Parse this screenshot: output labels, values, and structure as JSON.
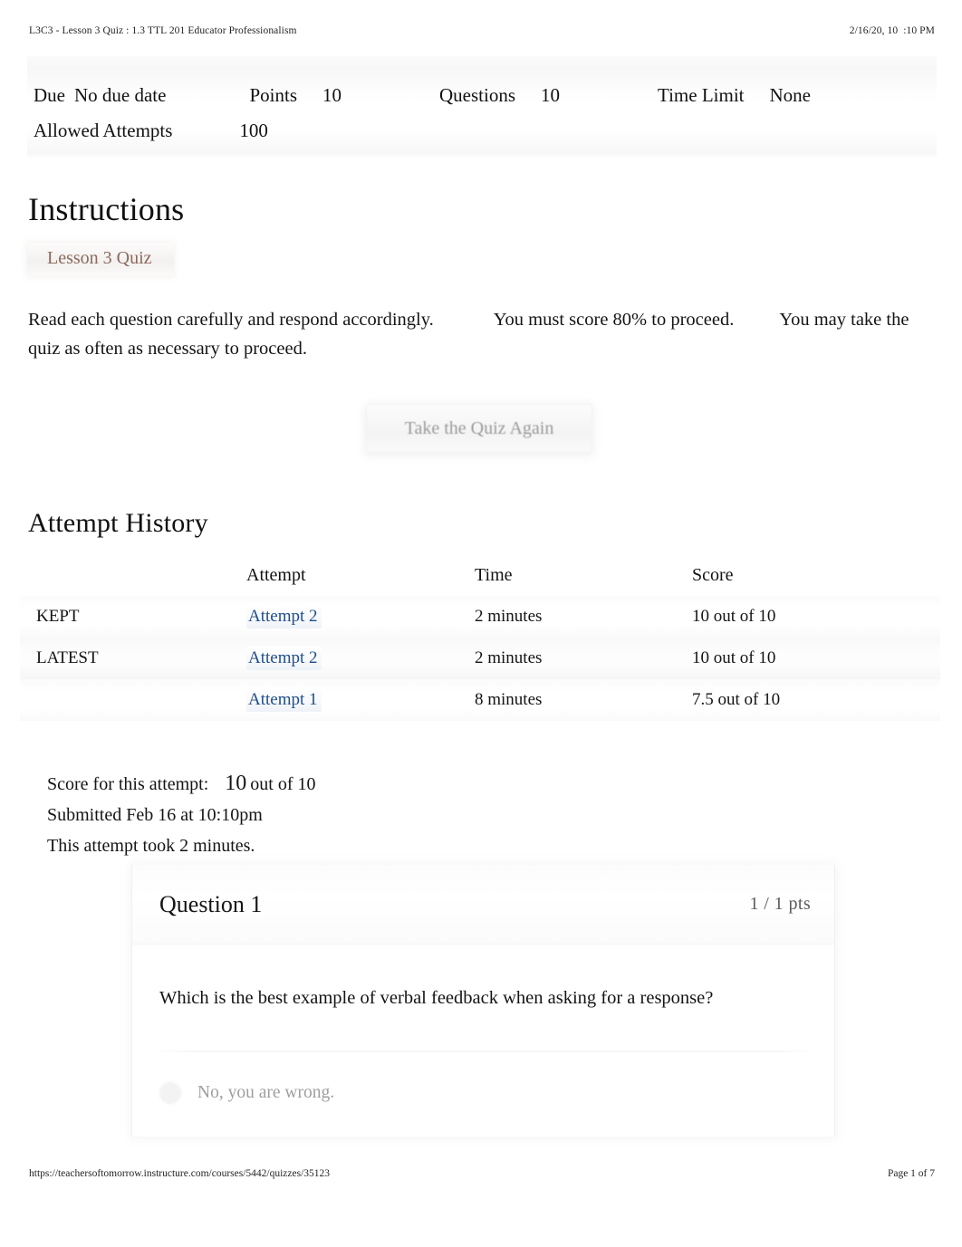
{
  "print_header": {
    "doc_title": "L3C3 - Lesson 3 Quiz : 1.3 TTL 201 Educator Professionalism",
    "timestamp": "2/16/20, 10  :10 PM"
  },
  "meta": {
    "due_label": "Due",
    "due_value": "No due date",
    "points_label": "Points",
    "points_value": "10",
    "questions_label": "Questions",
    "questions_value": "10",
    "time_limit_label": "Time Limit",
    "time_limit_value": "None",
    "allowed_attempts_label": "Allowed Attempts",
    "allowed_attempts_value": "100"
  },
  "instructions": {
    "heading": "Instructions",
    "quiz_chip": "Lesson 3 Quiz",
    "line1a": "Read each question carefully and respond accordingly.",
    "line1b": "You must score 80% to proceed.",
    "line1c": "You may",
    "line2": "take the quiz as often as necessary to proceed."
  },
  "retake": {
    "label": "Take the Quiz Again"
  },
  "attempt_history": {
    "heading": "Attempt History",
    "columns": [
      "",
      "Attempt",
      "Time",
      "Score"
    ],
    "rows": [
      {
        "status": "KEPT",
        "attempt": "Attempt 2",
        "time": "2 minutes",
        "score": "10 out of 10"
      },
      {
        "status": "LATEST",
        "attempt": "Attempt 2",
        "time": "2 minutes",
        "score": "10 out of 10"
      },
      {
        "status": "",
        "attempt": "Attempt 1",
        "time": "8 minutes",
        "score": "7.5 out of 10"
      }
    ]
  },
  "score_summary": {
    "score_label": "Score for this attempt:",
    "score_value": "10",
    "score_out_of": "out of 10",
    "submitted": "Submitted Feb 16 at 10:10pm",
    "duration": "This attempt took 2 minutes."
  },
  "question": {
    "title": "Question 1",
    "points": "1 / 1 pts",
    "text": "Which is the best example of verbal feedback when asking for a response?",
    "answer_option": "No, you are wrong."
  },
  "print_footer": {
    "url": "https://teachersoftomorrow.instructure.com/courses/5442/quizzes/35123",
    "page": "Page 1 of 7"
  },
  "colors": {
    "link": "#1f4e87",
    "quiz_chip_text": "#8a6a5d",
    "body_text": "#141414",
    "muted_text": "#9f9f9f"
  }
}
